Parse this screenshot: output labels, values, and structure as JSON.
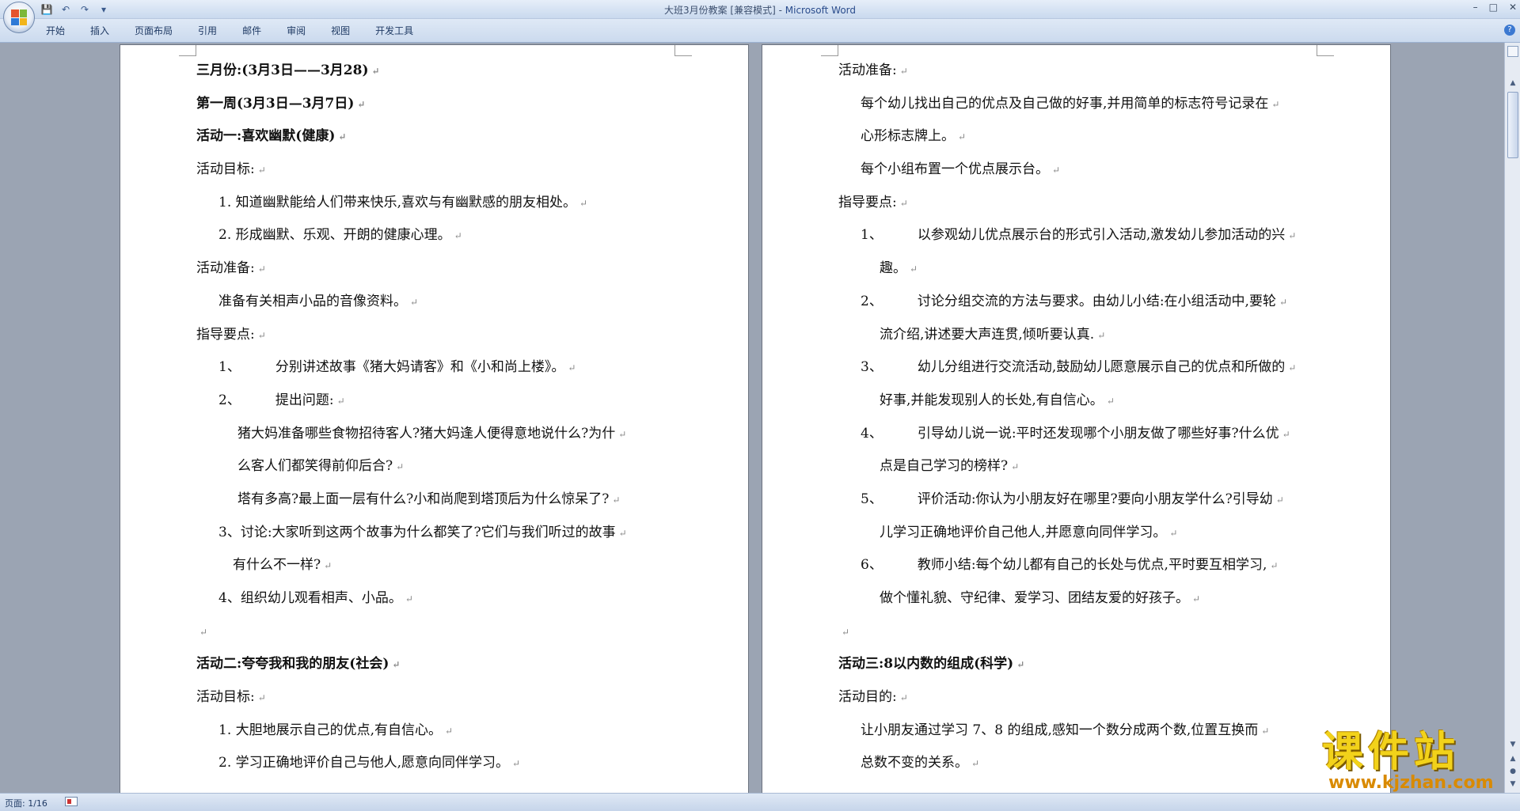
{
  "window": {
    "title": "大班3月份教案 [兼容模式] - ",
    "app_name": "Microsoft Word"
  },
  "menu": [
    "开始",
    "插入",
    "页面布局",
    "引用",
    "邮件",
    "审阅",
    "视图",
    "开发工具"
  ],
  "status": {
    "page": "页面: 1/16"
  },
  "page1": [
    {
      "text": "三月份:(3月3日——3月28)",
      "style": "b",
      "indent": ""
    },
    {
      "text": "第一周(3月3日—3月7日)",
      "style": "b",
      "indent": ""
    },
    {
      "text": "活动一:喜欢幽默(健康)",
      "style": "b",
      "indent": ""
    },
    {
      "text": "活动目标:",
      "style": "",
      "indent": ""
    },
    {
      "text": "1. 知道幽默能给人们带来快乐,喜欢与有幽默感的朋友相处。",
      "style": "",
      "indent": "i1"
    },
    {
      "text": "2. 形成幽默、乐观、开朗的健康心理。",
      "style": "",
      "indent": "i1"
    },
    {
      "text": "活动准备:",
      "style": "",
      "indent": ""
    },
    {
      "text": "准备有关相声小品的音像资料。",
      "style": "",
      "indent": "i1"
    },
    {
      "text": "指导要点:",
      "style": "",
      "indent": ""
    },
    {
      "num": "1、",
      "text": "分别讲述故事《猪大妈请客》和《小和尚上楼》。",
      "style": "",
      "indent": "i1"
    },
    {
      "num": "2、",
      "text": "提出问题:",
      "style": "",
      "indent": "i1"
    },
    {
      "text": "猪大妈准备哪些食物招待客人?猪大妈逢人便得意地说什么?为什",
      "style": "",
      "indent": "i2"
    },
    {
      "text": "么客人们都笑得前仰后合?",
      "style": "",
      "indent": "i2"
    },
    {
      "text": "塔有多高?最上面一层有什么?小和尚爬到塔顶后为什么惊呆了?",
      "style": "",
      "indent": "i2"
    },
    {
      "text": "3、讨论:大家听到这两个故事为什么都笑了?它们与我们听过的故事",
      "style": "",
      "indent": "i1"
    },
    {
      "text": "有什么不一样?",
      "style": "",
      "indent": "i3"
    },
    {
      "text": "4、组织幼儿观看相声、小品。",
      "style": "",
      "indent": "i1"
    },
    {
      "text": "",
      "style": "",
      "indent": ""
    },
    {
      "text": "活动二:夸夸我和我的朋友(社会)",
      "style": "b",
      "indent": ""
    },
    {
      "text": "活动目标:",
      "style": "",
      "indent": ""
    },
    {
      "text": "1. 大胆地展示自己的优点,有自信心。",
      "style": "",
      "indent": "i1"
    },
    {
      "text": "2. 学习正确地评价自己与他人,愿意向同伴学习。",
      "style": "",
      "indent": "i1"
    }
  ],
  "page2": [
    {
      "text": "活动准备:",
      "style": "",
      "indent": ""
    },
    {
      "text": "每个幼儿找出自己的优点及自己做的好事,并用简单的标志符号记录在",
      "style": "",
      "indent": "i1"
    },
    {
      "text": "心形标志牌上。",
      "style": "",
      "indent": "i1"
    },
    {
      "text": "每个小组布置一个优点展示台。",
      "style": "",
      "indent": "i1"
    },
    {
      "text": "指导要点:",
      "style": "",
      "indent": ""
    },
    {
      "num": "1、",
      "text": "以参观幼儿优点展示台的形式引入活动,激发幼儿参加活动的兴",
      "style": "",
      "indent": "i1"
    },
    {
      "text": "趣。",
      "style": "",
      "indent": "i2"
    },
    {
      "num": "2、",
      "text": "讨论分组交流的方法与要求。由幼儿小结:在小组活动中,要轮",
      "style": "",
      "indent": "i1"
    },
    {
      "text": "流介绍,讲述要大声连贯,倾听要认真.",
      "style": "",
      "indent": "i2"
    },
    {
      "num": "3、",
      "text": "幼儿分组进行交流活动,鼓励幼儿愿意展示自己的优点和所做的",
      "style": "",
      "indent": "i1"
    },
    {
      "text": "好事,并能发现别人的长处,有自信心。",
      "style": "",
      "indent": "i2"
    },
    {
      "num": "4、",
      "text": "引导幼儿说一说:平时还发现哪个小朋友做了哪些好事?什么优",
      "style": "",
      "indent": "i1"
    },
    {
      "text": "点是自己学习的榜样?",
      "style": "",
      "indent": "i2"
    },
    {
      "num": "5、",
      "text": "评价活动:你认为小朋友好在哪里?要向小朋友学什么?引导幼",
      "style": "",
      "indent": "i1"
    },
    {
      "text": "儿学习正确地评价自己他人,并愿意向同伴学习。",
      "style": "",
      "indent": "i2"
    },
    {
      "num": "6、",
      "text": "教师小结:每个幼儿都有自己的长处与优点,平时要互相学习,",
      "style": "",
      "indent": "i1"
    },
    {
      "text": "做个懂礼貌、守纪律、爱学习、团结友爱的好孩子。",
      "style": "",
      "indent": "i2"
    },
    {
      "text": "",
      "style": "",
      "indent": ""
    },
    {
      "text": "活动三:8以内数的组成(科学)",
      "style": "b",
      "indent": ""
    },
    {
      "text": "活动目的:",
      "style": "",
      "indent": ""
    },
    {
      "text": "让小朋友通过学习 7、8 的组成,感知一个数分成两个数,位置互换而",
      "style": "",
      "indent": "i1"
    },
    {
      "text": "总数不变的关系。",
      "style": "",
      "indent": "i1"
    }
  ],
  "watermark": {
    "title": "课件站",
    "url": "www.kjzhan.com"
  }
}
